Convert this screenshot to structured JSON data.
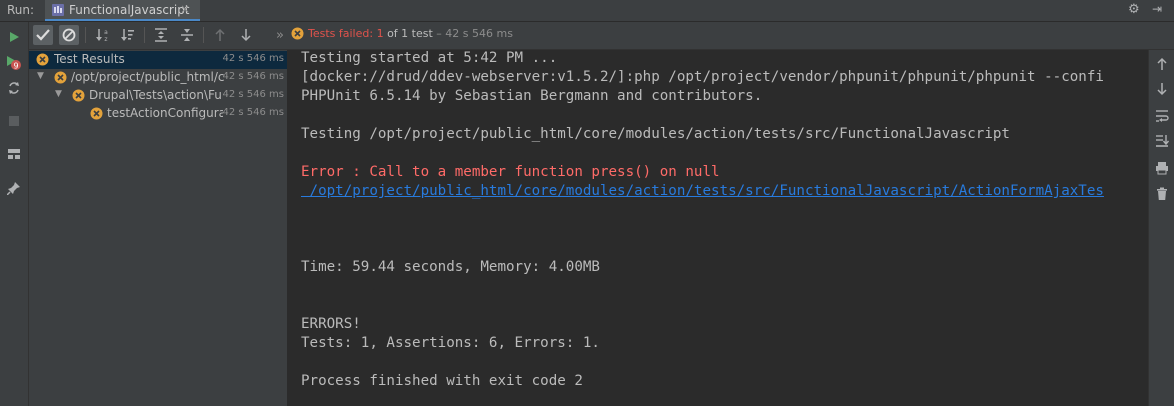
{
  "window": {
    "run_label": "Run:",
    "tab_title": "FunctionalJavascript",
    "tab_close": "×",
    "settings_glyph": "⚙",
    "hide_glyph": "⇥"
  },
  "toolbar": {
    "status_failed": "Tests failed: 1",
    "status_count": " of 1 test",
    "status_time": " – 42 s 546 ms",
    "more_glyph": "»"
  },
  "colors": {
    "error": "#ff6b68",
    "link": "#287bde",
    "fail_icon": "#e3a23b",
    "run_green": "#59a869"
  },
  "tree": {
    "rows": [
      {
        "label": "Test Results",
        "duration": "42 s 546 ms"
      },
      {
        "label": "/opt/project/public_html/co",
        "duration": "42 s 546 ms"
      },
      {
        "label": "Drupal\\Tests\\action\\Func",
        "duration": "42 s 546 ms"
      },
      {
        "label": "testActionConfigurati",
        "duration": "42 s 546 ms"
      }
    ]
  },
  "console": {
    "lines": [
      "Testing started at 5:42 PM ...",
      "[docker://drud/ddev-webserver:v1.5.2/]:php /opt/project/vendor/phpunit/phpunit/phpunit --confi",
      "PHPUnit 6.5.14 by Sebastian Bergmann and contributors.",
      "Testing /opt/project/public_html/core/modules/action/tests/src/FunctionalJavascript",
      "Error : Call to a member function press() on null",
      " /opt/project/public_html/core/modules/action/tests/src/FunctionalJavascript/ActionFormAjaxTes",
      "Time: 59.44 seconds, Memory: 4.00MB",
      "ERRORS!",
      "Tests: 1, Assertions: 6, Errors: 1.",
      "Process finished with exit code 2"
    ]
  }
}
